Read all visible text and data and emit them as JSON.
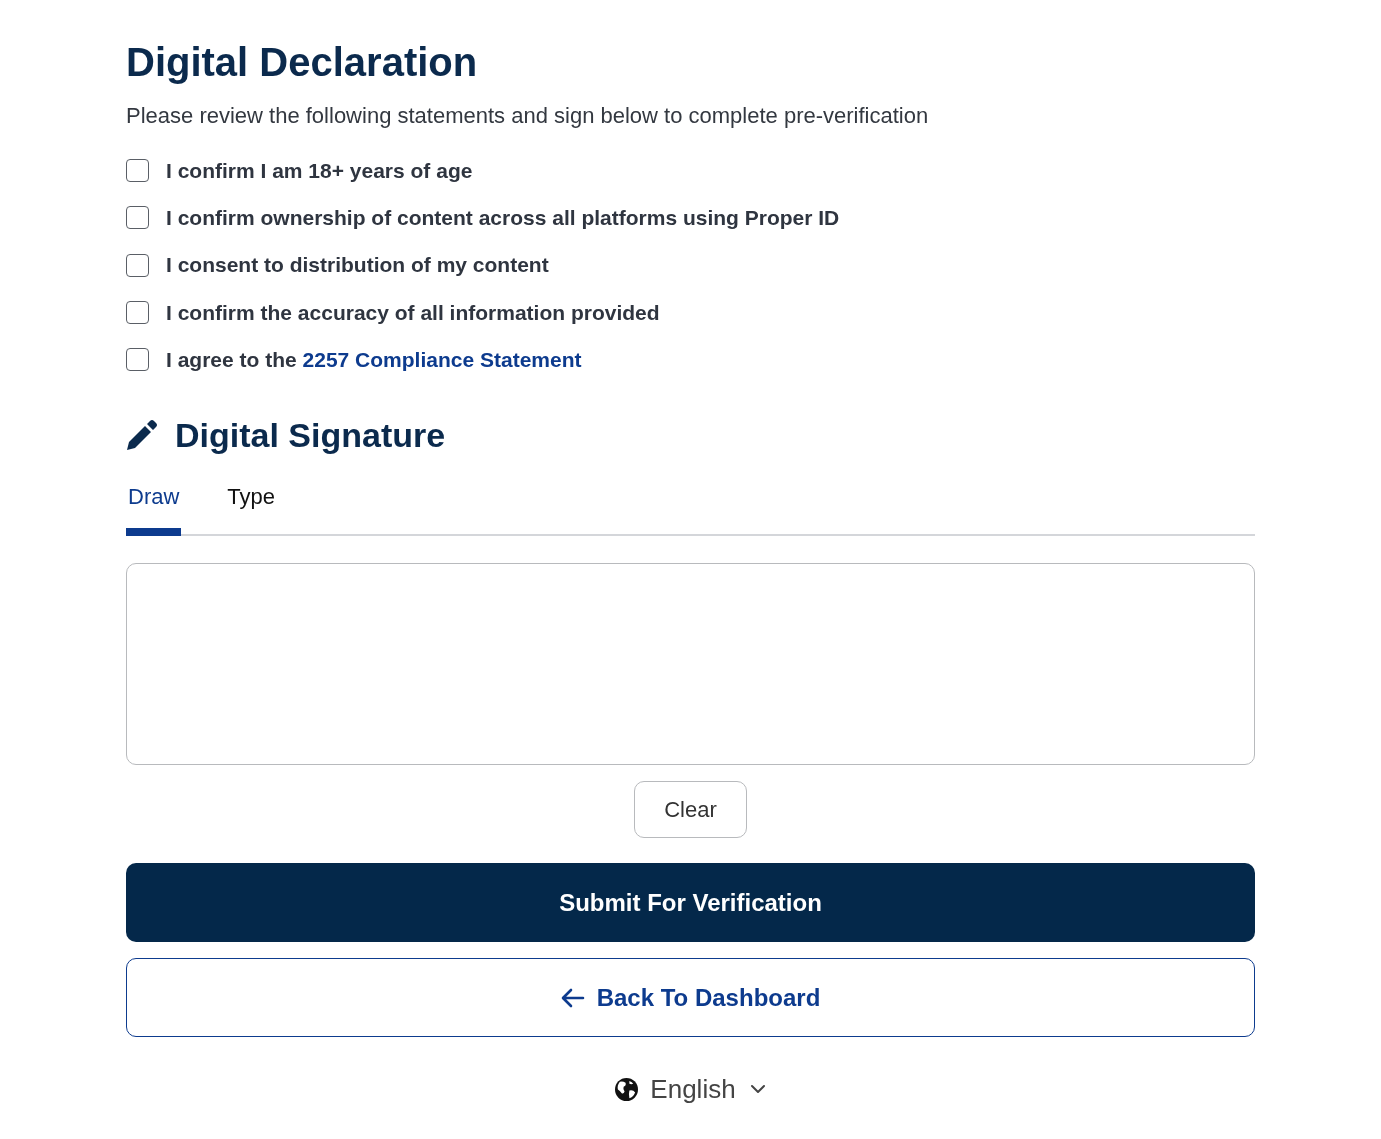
{
  "title": "Digital Declaration",
  "subtitle": "Please review the following statements and sign below to complete pre-verification",
  "statements": [
    {
      "text": "I confirm I am 18+ years of age",
      "checked": false
    },
    {
      "text": "I confirm ownership of content across all platforms using Proper ID",
      "checked": false
    },
    {
      "text": "I consent to distribution of my content",
      "checked": false
    },
    {
      "text": "I confirm the accuracy of all information provided",
      "checked": false
    },
    {
      "text": "I agree to the",
      "link": "2257 Compliance Statement",
      "checked": false
    }
  ],
  "signature": {
    "heading": "Digital Signature",
    "tabs": [
      {
        "label": "Draw",
        "selected": true
      },
      {
        "label": "Type",
        "selected": false
      }
    ],
    "clear_button": "Clear"
  },
  "submit_button": "Submit For Verification",
  "back_button": "Back To Dashboard",
  "language": "English"
}
